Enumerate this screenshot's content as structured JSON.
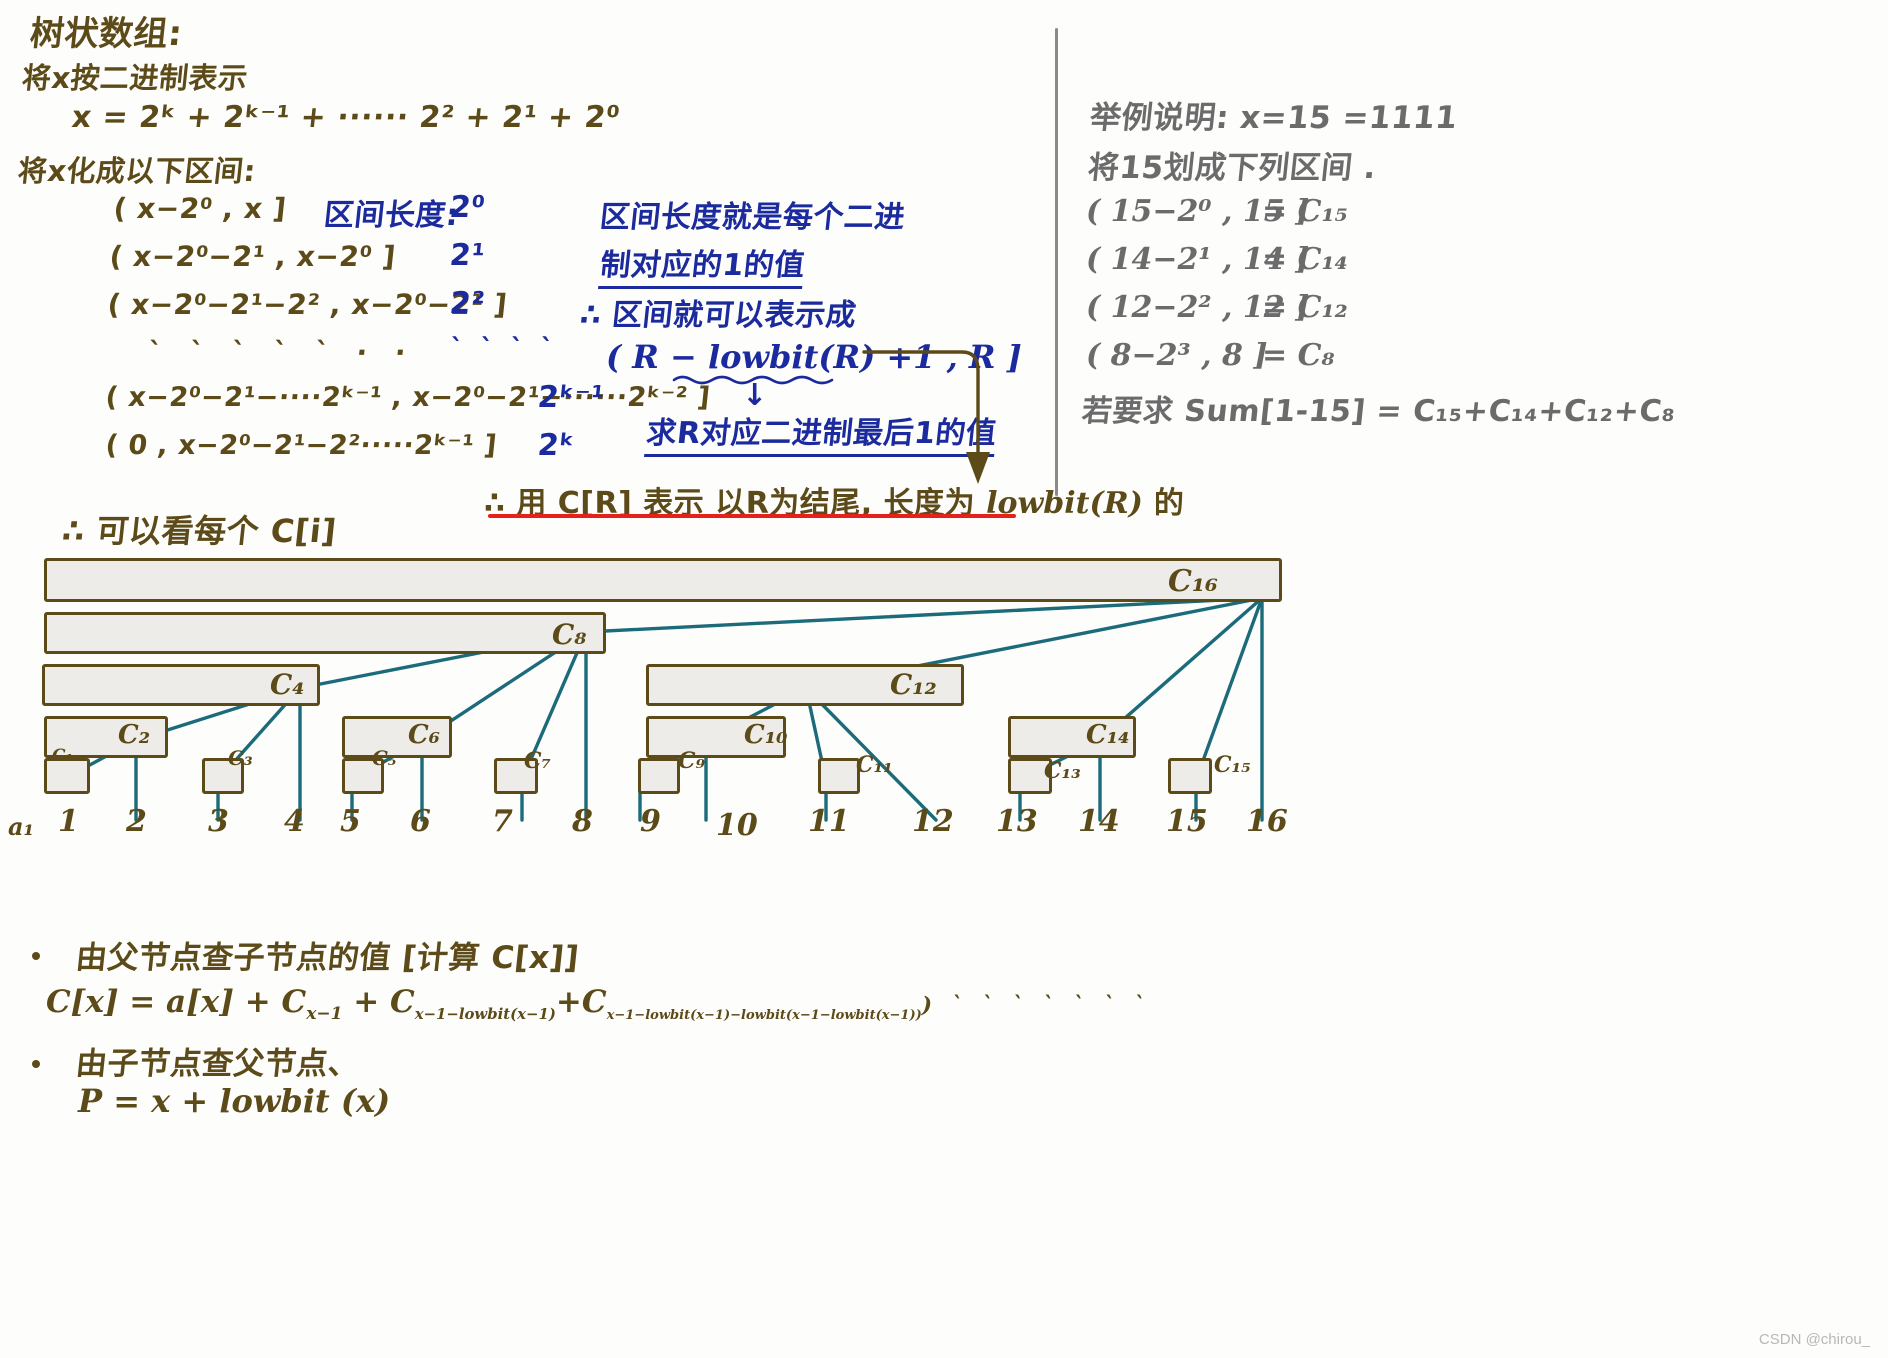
{
  "meta": {
    "watermark": "CSDN @chirou_"
  },
  "colors": {
    "ink_brown": "#5c4a18",
    "ink_blue": "#1b2a9c",
    "ink_gray": "#6b6b6b",
    "ink_red": "#e8201b",
    "edge_teal": "#1b6b7a",
    "node_fill": "#edece8"
  },
  "left": {
    "title": "树状数组:",
    "sub1": "将x按二进制表示",
    "expr1": "x = 2ᵏ + 2ᵏ⁻¹ + ······ 2² + 2¹ + 2⁰",
    "sub2": "将x化成以下区间:",
    "interval_header_label": "区间长度:",
    "intervals": [
      {
        "range": "( x−2⁰ , x ]",
        "length": "2⁰"
      },
      {
        "range": "( x−2⁰−2¹ , x−2⁰ ]",
        "length": "2¹"
      },
      {
        "range": "( x−2⁰−2¹−2² , x−2⁰−2¹ ]",
        "length": "2²"
      },
      {
        "range": "`  `  `  `  ` · ·",
        "length": "` ` ` `"
      },
      {
        "range": "( x−2⁰−2¹−····2ᵏ⁻¹ , x−2⁰−2¹−······2ᵏ⁻² ]",
        "length": "2ᵏ⁻¹"
      },
      {
        "range": "( 0 ,  x−2⁰−2¹−2²·····2ᵏ⁻¹ ]",
        "length": "2ᵏ"
      }
    ]
  },
  "middle": {
    "note1_line1": "区间长度就是每个二进",
    "note1_line2": "制对应的1的值",
    "note2": "∴ 区间就可以表示成",
    "formula": "( R − lowbit(R) +1 ,  R ]",
    "arrow_glyph": "↓",
    "note3": "求R对应二进制最后1的值",
    "conclusion_prefix": "∴ 用 C[R] 表示 以R为结尾, 长度为 ",
    "conclusion_mono": "lowbit(R)",
    "conclusion_suffix": " 的",
    "tree_caption": "∴ 可以看每个 C[i]"
  },
  "right": {
    "line1": "举例说明:  x=15 =1111",
    "line2": "将15划成下列区间 .",
    "rows": [
      {
        "range": "( 15−2⁰ , 15 ]",
        "eq": "= C₁₅"
      },
      {
        "range": "( 14−2¹ , 14 ]",
        "eq": "= C₁₄"
      },
      {
        "range": "( 12−2² , 12 ]",
        "eq": "= C₁₂"
      },
      {
        "range": "( 8−2³ , 8 ]",
        "eq": "= C₈"
      }
    ],
    "sum_line": "若要求 Sum[1-15] = C₁₅+C₁₄+C₁₂+C₈"
  },
  "tree": {
    "origin_label": "a₁",
    "axis_numbers": [
      "1",
      "2",
      "3",
      "4",
      "5",
      "6",
      "7",
      "8",
      "9",
      "10",
      "11",
      "12",
      "13",
      "14",
      "15",
      "16"
    ],
    "nodes": [
      {
        "label": "C₁₆",
        "level": 4,
        "covers": [
          1,
          16
        ]
      },
      {
        "label": "C₈",
        "level": 3,
        "covers": [
          1,
          8
        ]
      },
      {
        "label": "C₄",
        "level": 2,
        "covers": [
          1,
          4
        ]
      },
      {
        "label": "C₁₂",
        "level": 2,
        "covers": [
          9,
          12
        ]
      },
      {
        "label": "C₂",
        "level": 1,
        "covers": [
          1,
          2
        ]
      },
      {
        "label": "C₆",
        "level": 1,
        "covers": [
          5,
          6
        ]
      },
      {
        "label": "C₁₀",
        "level": 1,
        "covers": [
          9,
          10
        ]
      },
      {
        "label": "C₁₄",
        "level": 1,
        "covers": [
          13,
          14
        ]
      },
      {
        "label": "C₁",
        "level": 0,
        "covers": [
          1,
          1
        ]
      },
      {
        "label": "C₃",
        "level": 0,
        "covers": [
          3,
          3
        ]
      },
      {
        "label": "C₅",
        "level": 0,
        "covers": [
          5,
          5
        ]
      },
      {
        "label": "C₇",
        "level": 0,
        "covers": [
          7,
          7
        ]
      },
      {
        "label": "C₉",
        "level": 0,
        "covers": [
          9,
          9
        ]
      },
      {
        "label": "C₁₁",
        "level": 0,
        "covers": [
          11,
          11
        ]
      },
      {
        "label": "C₁₃",
        "level": 0,
        "covers": [
          13,
          13
        ]
      },
      {
        "label": "C₁₅",
        "level": 0,
        "covers": [
          15,
          15
        ]
      }
    ]
  },
  "bottom": {
    "bullet1": "由父节点查子节点的值 [计算 C[x]]",
    "formula1": "C[x] = a[x] + C",
    "formula1_sub1": "x−1",
    "formula1_plus": " + C",
    "formula1_sub2": "x−1−lowbit(x−1)",
    "formula1_plus2": "+C",
    "formula1_sub3": "x−1−lowbit(x−1)−lowbit(x−1−lowbit(x−1))",
    "formula1_tail": ") ` ` ` ` ` ` `",
    "bullet2": "由子节点查父节点、",
    "formula2": "P = x + lowbit (x)"
  }
}
